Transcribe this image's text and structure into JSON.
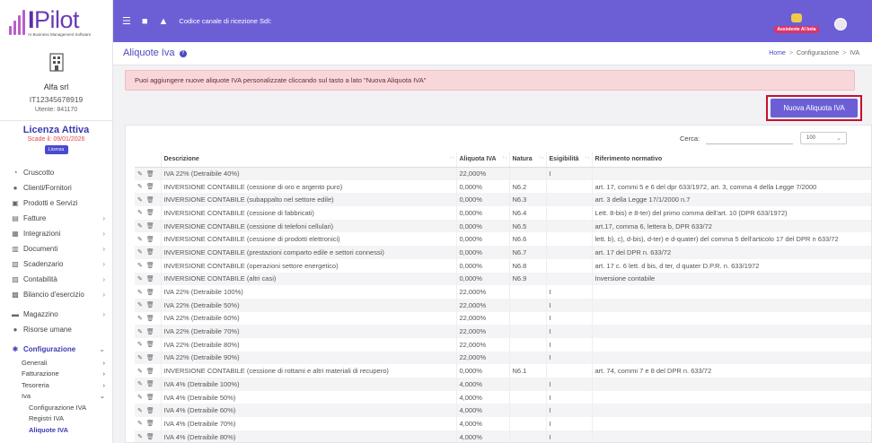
{
  "logo": {
    "brand_prefix": "I",
    "brand_name": "Pilot",
    "tagline": "AI Business Management Software"
  },
  "company": {
    "name": "Alfa srl",
    "vat": "IT12345678919",
    "user": "Utente: 841170"
  },
  "license": {
    "title": "Licenza Attiva",
    "expiry": "Scade il: 09/01/2026",
    "button_label": "Licenza"
  },
  "sidebar": {
    "items": [
      {
        "icon": "dashboard-icon",
        "label": "Cruscotto",
        "arrow": ""
      },
      {
        "icon": "user-icon",
        "label": "Clienti/Fornitori",
        "arrow": ""
      },
      {
        "icon": "box-icon",
        "label": "Prodotti e Servizi",
        "arrow": ""
      },
      {
        "icon": "invoice-icon",
        "label": "Fatture",
        "arrow": "›"
      },
      {
        "icon": "integration-icon",
        "label": "Integrazioni",
        "arrow": "›"
      },
      {
        "icon": "document-icon",
        "label": "Documenti",
        "arrow": "›"
      },
      {
        "icon": "calendar-icon",
        "label": "Scadenzario",
        "arrow": "›"
      },
      {
        "icon": "accounting-icon",
        "label": "Contabilità",
        "arrow": "›"
      },
      {
        "icon": "balance-icon",
        "label": "Bilancio d'esercizio",
        "arrow": "›"
      },
      {
        "icon": "warehouse-icon",
        "label": "Magazzino",
        "arrow": "›"
      },
      {
        "icon": "people-icon",
        "label": "Risorse umane",
        "arrow": ""
      },
      {
        "icon": "gear-icon",
        "label": "Configurazione",
        "arrow": "⌄"
      }
    ],
    "sub_items": [
      {
        "label": "Generali",
        "arrow": "›"
      },
      {
        "label": "Fatturazione",
        "arrow": "›"
      },
      {
        "label": "Tesoreria",
        "arrow": "›"
      },
      {
        "label": "Iva",
        "arrow": "⌄"
      }
    ],
    "iva_items": [
      {
        "label": "Configurazione IVA"
      },
      {
        "label": "Registri IVA"
      },
      {
        "label": "Aliquote IVA"
      }
    ]
  },
  "topbar": {
    "menu_icon": "☰",
    "chat_icon": "■",
    "bell_icon": "▲",
    "channel_text": "Codice canale di ricezione SdI:",
    "assistant_label": "Assistente AI beta"
  },
  "header": {
    "title": "Aliquote Iva",
    "help": "?",
    "breadcrumb": [
      "Home",
      "Configurazione",
      "IVA"
    ]
  },
  "alert": {
    "text": "Puoi aggiungere nuove aliquote IVA personalizzate cliccando sul tasto a lato \"Nuova Aliquota IVA\""
  },
  "actions": {
    "new_button": "Nuova Aliquota IVA"
  },
  "table": {
    "search_label": "Cerca:",
    "search_value": "",
    "page_size": "100",
    "page_size_arrow": "⌄",
    "edit_icon": "✎",
    "delete_icon": "🗑",
    "columns": [
      "",
      "Descrizione",
      "Aliquota IVA",
      "Natura",
      "Esigibilità",
      "Riferimento normativo"
    ],
    "sort_glyph": "↑↓",
    "rows": [
      [
        "IVA 22% (Detraibile 40%)",
        "22,000%",
        "",
        "I",
        ""
      ],
      [
        "INVERSIONE CONTABILE (cessione di oro e argento puro)",
        "0,000%",
        "N6.2",
        "",
        "art. 17, commi 5 e 6 del dpr 633/1972, art. 3, comma 4 della Legge 7/2000"
      ],
      [
        "INVERSIONE CONTABILE (subappalto nel settore edile)",
        "0,000%",
        "N6.3",
        "",
        "art. 3 della Legge 17/1/2000 n.7"
      ],
      [
        "INVERSIONE CONTABILE (cessione di fabbricati)",
        "0,000%",
        "N6.4",
        "",
        "Lett. 8-bis) e 8-ter) del primo comma dell'art. 10 (DPR 633/1972)"
      ],
      [
        "INVERSIONE CONTABILE (cessione di telefoni cellulari)",
        "0,000%",
        "N6.5",
        "",
        "art.17, comma 6, lettera b, DPR 633/72"
      ],
      [
        "INVERSIONE CONTABILE (cessione di prodotti elettronici)",
        "0,000%",
        "N6.6",
        "",
        "lett. b), c), d-bis), d-ter) e d-quater) del comma 5 dell'articolo 17 del DPR n 633/72"
      ],
      [
        "INVERSIONE CONTABILE (prestazioni comparto edile e settori connessi)",
        "0,000%",
        "N6.7",
        "",
        "art. 17 del DPR n. 633/72"
      ],
      [
        "INVERSIONE CONTABILE (operazioni settore energetico)",
        "0,000%",
        "N6.8",
        "",
        " art. 17 c. 6 lett. d bis, d ter, d quater D.P.R. n. 633/1972"
      ],
      [
        "INVERSIONE CONTABILE (altri casi)",
        "0,000%",
        "N6.9",
        "",
        "Inversione contabile"
      ],
      [
        "IVA 22% (Detraibile 100%)",
        "22,000%",
        "",
        "I",
        ""
      ],
      [
        "IVA 22% (Detraibile 50%)",
        "22,000%",
        "",
        "I",
        ""
      ],
      [
        "IVA 22% (Detraibile 60%)",
        "22,000%",
        "",
        "I",
        ""
      ],
      [
        "IVA 22% (Detraibile 70%)",
        "22,000%",
        "",
        "I",
        ""
      ],
      [
        "IVA 22% (Detraibile 80%)",
        "22,000%",
        "",
        "I",
        ""
      ],
      [
        "IVA 22% (Detraibile 90%)",
        "22,000%",
        "",
        "I",
        ""
      ],
      [
        "INVERSIONE CONTABILE (cessione di rottami e altri materiali di recupero)",
        "0,000%",
        "N6.1",
        "",
        "art. 74, commi 7 e 8 del DPR n. 633/72"
      ],
      [
        "IVA 4% (Detraibile 100%)",
        "4,000%",
        "",
        "I",
        ""
      ],
      [
        "IVA 4% (Detraibile 50%)",
        "4,000%",
        "",
        "I",
        ""
      ],
      [
        "IVA 4% (Detraibile 60%)",
        "4,000%",
        "",
        "I",
        ""
      ],
      [
        "IVA 4% (Detraibile 70%)",
        "4,000%",
        "",
        "I",
        ""
      ],
      [
        "IVA 4% (Detraibile 80%)",
        "4,000%",
        "",
        "I",
        ""
      ]
    ]
  },
  "colors": {
    "primary": "#6c5fd6",
    "brand": "#6a3bb6",
    "alert_bg": "#f8d7da",
    "highlight": "#c8102e",
    "accent_text": "#3b3bb0",
    "license_expiry": "#e24a4a"
  }
}
